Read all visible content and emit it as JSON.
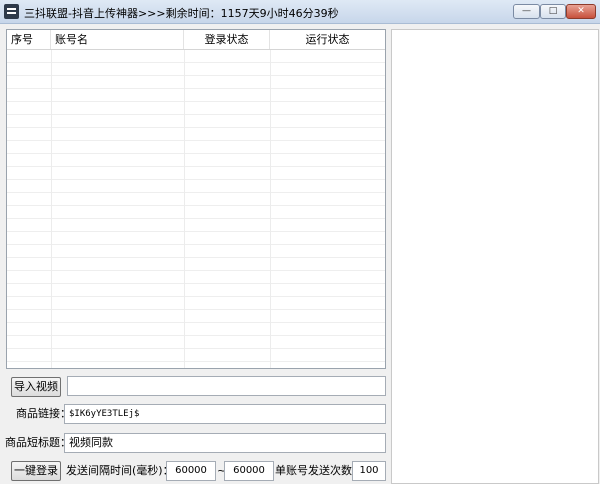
{
  "window": {
    "title": "三抖联盟-抖音上传神器>>>剩余时间：1157天9小时46分39秒",
    "min_label": "—",
    "max_label": "□",
    "close_label": "✕"
  },
  "table": {
    "columns": [
      "序号",
      "账号名",
      "登录状态",
      "运行状态"
    ],
    "rows": []
  },
  "controls": {
    "import_button": "导入视频",
    "video_path": "",
    "product_link_label": "商品链接：",
    "product_link_value": "$IK6yYE3TLEj$",
    "short_title_label": "商品短标题：",
    "short_title_value": "视频同款",
    "login_button": "一键登录",
    "interval_label": "发送间隔时间(毫秒)：",
    "interval_min": "60000",
    "interval_sep": "~",
    "interval_max": "60000",
    "send_count_label": "单账号发送次数：",
    "send_count": "100"
  }
}
